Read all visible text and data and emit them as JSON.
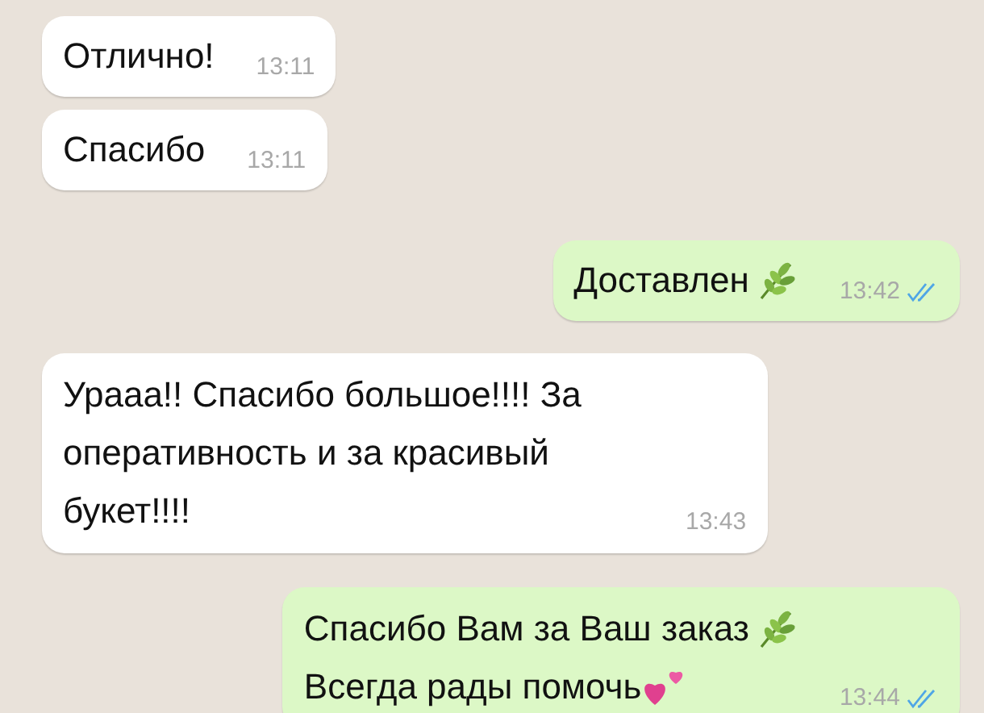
{
  "messages": [
    {
      "kind": "incoming",
      "lines": [
        {
          "kind": "plain",
          "text": "Отлично!"
        }
      ],
      "time": "13:11"
    },
    {
      "kind": "incoming",
      "lines": [
        {
          "kind": "plain",
          "text": "Спасибо"
        }
      ],
      "time": "13:11"
    },
    {
      "kind": "outgoing",
      "lines": [
        {
          "kind": "leaf",
          "text": "Доставлен"
        }
      ],
      "time": "13:42",
      "read": true
    },
    {
      "kind": "incoming",
      "lines": [
        {
          "kind": "plain",
          "text": "Урааа!! Спасибо большое!!!! За оперативность и за красивый букет!!!!"
        }
      ],
      "time": "13:43"
    },
    {
      "kind": "outgoing",
      "lines": [
        {
          "kind": "leaf",
          "text": "Спасибо Вам за Ваш заказ"
        },
        {
          "kind": "hearts",
          "text": "Всегда рады помочь"
        }
      ],
      "time": "13:44",
      "read": true
    }
  ]
}
